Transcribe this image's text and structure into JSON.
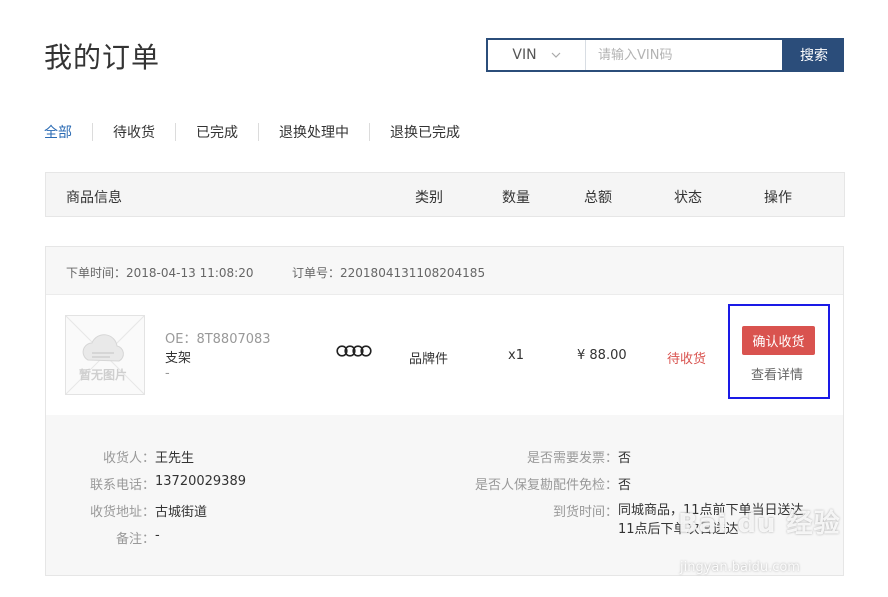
{
  "page": {
    "title": "我的订单"
  },
  "search": {
    "type_value": "VIN",
    "placeholder": "请输入VIN码",
    "button_label": "搜索"
  },
  "tabs": [
    {
      "label": "全部",
      "active": true
    },
    {
      "label": "待收货",
      "active": false
    },
    {
      "label": "已完成",
      "active": false
    },
    {
      "label": "退换处理中",
      "active": false
    },
    {
      "label": "退换已完成",
      "active": false
    }
  ],
  "table_header": {
    "product_info": "商品信息",
    "category": "类别",
    "quantity": "数量",
    "total": "总额",
    "status": "状态",
    "action": "操作"
  },
  "order": {
    "order_time_label": "下单时间：",
    "order_time": "2018-04-13 11:08:20",
    "order_no_label": "订单号：",
    "order_no": "2201804131108204185",
    "product": {
      "thumb_text": "暂无图片",
      "oe": "OE：8T8807083",
      "name": "支架",
      "extra": "-",
      "brand_icon": "audi-rings-icon",
      "category": "品牌件",
      "quantity": "x1",
      "total": "¥ 88.00",
      "status": "待收货",
      "confirm_label": "确认收货",
      "detail_label": "查看详情"
    },
    "shipping": {
      "recipient_label": "收货人：",
      "recipient": "王先生",
      "phone_label": "联系电话：",
      "phone": "13720029389",
      "address_label": "收货地址：",
      "address": "古城街道",
      "note_label": "备注：",
      "note": "-",
      "invoice_label": "是否需要发票：",
      "invoice": "否",
      "insurance_label": "是否人保复勘配件免检：",
      "insurance": "否",
      "delivery_label": "到货时间：",
      "delivery_line1": "同城商品，11点前下单当日送达，",
      "delivery_line2": "11点后下单次日送达"
    }
  },
  "watermark": {
    "text": "Bai du 经验",
    "sub": "jingyan.baidu.com"
  },
  "colors": {
    "brand_blue": "#2b4d7a",
    "active_tab": "#2a6ab3",
    "status_red": "#d9534f",
    "highlight_border": "#1a1ae6"
  }
}
